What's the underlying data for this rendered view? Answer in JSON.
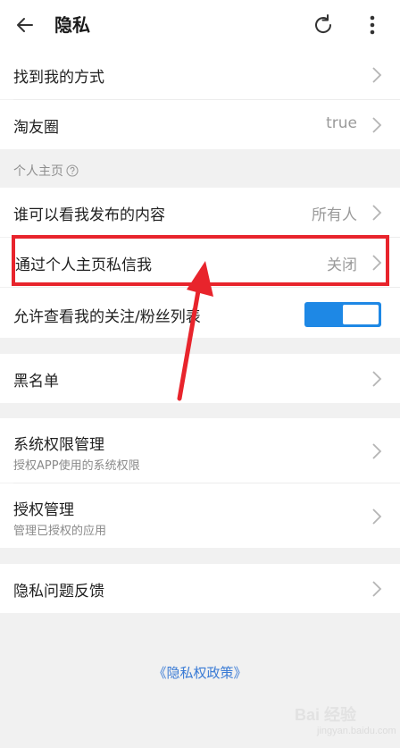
{
  "header": {
    "title": "隐私"
  },
  "rows": {
    "find_me": {
      "label": "找到我的方式"
    },
    "circle": {
      "label": "淘友圈",
      "value": "true"
    },
    "who_can_see": {
      "label": "谁可以看我发布的内容",
      "value": "所有人"
    },
    "dm_via_home": {
      "label": "通过个人主页私信我",
      "value": "关闭"
    },
    "allow_view_follow": {
      "label": "允许查看我的关注/粉丝列表",
      "toggle_on": true
    },
    "blacklist": {
      "label": "黑名单"
    },
    "system_perm": {
      "label": "系统权限管理",
      "sub": "授权APP使用的系统权限"
    },
    "auth_manage": {
      "label": "授权管理",
      "sub": "管理已授权的应用"
    },
    "feedback": {
      "label": "隐私问题反馈"
    }
  },
  "section": {
    "home_header": "个人主页"
  },
  "footer": {
    "policy_link": "《隐私权政策》"
  },
  "watermark": {
    "text": "Bai 经验",
    "sub": "jingyan.baidu.com"
  },
  "colors": {
    "accent": "#1e88e5",
    "highlight": "#e8242c",
    "link": "#3a7bd5"
  },
  "icons": [
    "back-arrow-icon",
    "refresh-icon",
    "more-vert-icon",
    "chevron-right-icon",
    "help-circle-icon"
  ]
}
